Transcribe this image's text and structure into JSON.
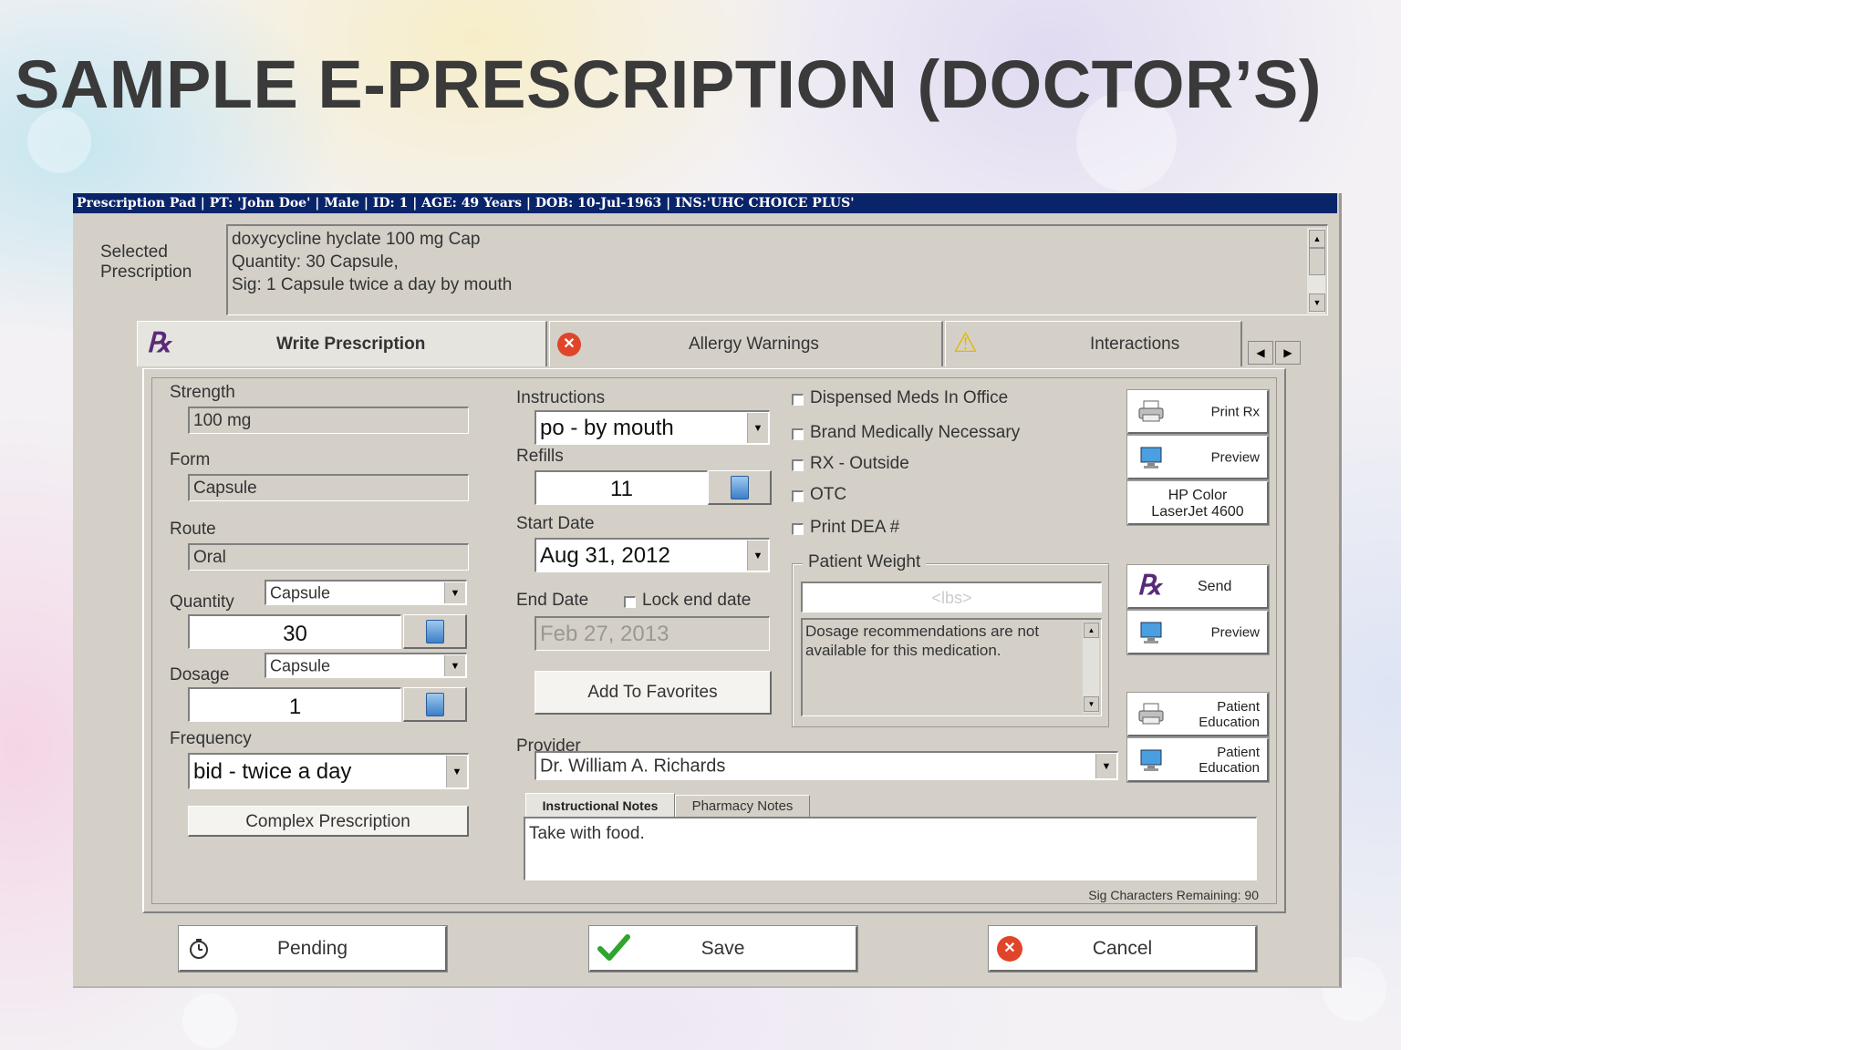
{
  "slide": {
    "title": "SAMPLE E-PRESCRIPTION (DOCTOR’S)"
  },
  "window": {
    "title": "Prescription Pad | PT: 'John Doe' | Male | ID: 1 | AGE: 49 Years | DOB: 10-Jul-1963 | INS:'UHC CHOICE PLUS'"
  },
  "selected": {
    "label_line1": "Selected",
    "label_line2": "Prescription",
    "line1": "doxycycline hyclate 100 mg Cap",
    "line2": "Quantity: 30 Capsule,",
    "line3": "Sig:  1 Capsule twice a day  by mouth"
  },
  "tabs": {
    "write": "Write Prescription",
    "allergy": "Allergy Warnings",
    "interactions": "Interactions"
  },
  "left": {
    "strength_label": "Strength",
    "strength_value": "100 mg",
    "form_label": "Form",
    "form_value": "Capsule",
    "route_label": "Route",
    "route_value": "Oral",
    "quantity_label": "Quantity",
    "quantity_unit": "Capsule",
    "quantity_value": "30",
    "dosage_label": "Dosage",
    "dosage_unit": "Capsule",
    "dosage_value": "1",
    "frequency_label": "Frequency",
    "frequency_value": "bid  - twice a day",
    "complex_button": "Complex Prescription"
  },
  "middle": {
    "instructions_label": "Instructions",
    "instructions_value": "po - by mouth",
    "refills_label": "Refills",
    "refills_value": "11",
    "start_label": "Start Date",
    "start_value": "Aug 31, 2012",
    "end_label": "End Date",
    "lock_label": "Lock end date",
    "end_value": "Feb 27, 2013",
    "favorites_button": "Add To Favorites",
    "provider_label": "Provider",
    "provider_value": "Dr. William A. Richards"
  },
  "options": {
    "dispensed": "Dispensed Meds In Office",
    "brand": "Brand Medically Necessary",
    "rx_outside": "RX - Outside",
    "otc": "OTC",
    "print_dea": "Print DEA #"
  },
  "weight": {
    "label": "Patient Weight",
    "placeholder": "<lbs>",
    "message": "Dosage recommendations are not available for this medication."
  },
  "side": {
    "print_rx": "Print Rx",
    "preview1": "Preview",
    "printer_line1": "HP Color",
    "printer_line2": "LaserJet 4600",
    "send": "Send",
    "preview2": "Preview",
    "pe_line1": "Patient",
    "pe_line2": "Education"
  },
  "notes": {
    "tab_instructional": "Instructional Notes",
    "tab_pharmacy": "Pharmacy Notes",
    "text": "Take with food.",
    "remaining": "Sig Characters Remaining: 90"
  },
  "bottom": {
    "pending": "Pending",
    "save": "Save",
    "cancel": "Cancel"
  }
}
